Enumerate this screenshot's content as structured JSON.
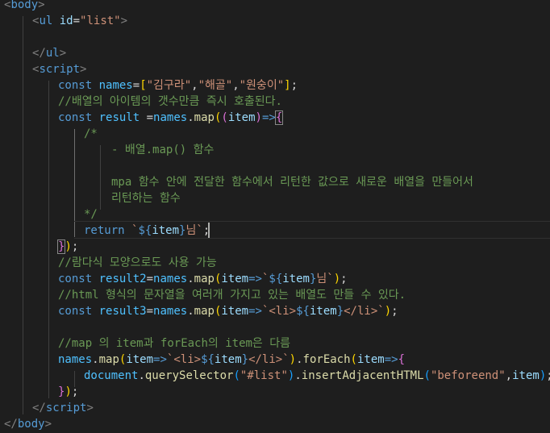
{
  "editor": {
    "html": {
      "body_tag": "body",
      "ul_tag": "ul",
      "id_attr": "id",
      "list_id_value": "\"list\"",
      "script_tag": "script"
    },
    "code": {
      "const_kw": "const",
      "names_var": "names",
      "names_array_strings": [
        "\"김구라\"",
        "\"해골\"",
        "\"원숭이\""
      ],
      "comment_1": "//배열의 아이템의 갯수만큼 즉시 호출된다.",
      "result_var": "result",
      "map_fn": "map",
      "item_param": "item",
      "block_comment_open": "/*",
      "block_comment_line_1": "- 배열.map() 함수",
      "block_comment_line_2": "mpa 함수 안에 전달한 함수에서 리턴한 값으로 새로운 배열을 만들어서",
      "block_comment_line_3": "리턴하는 함수",
      "block_comment_close": "*/",
      "return_kw": "return",
      "tpl_suffix_nim": "님`",
      "comment_2": "//람다식 모양으로도 사용 가능",
      "result2_var": "result2",
      "comment_3": "//html 형식의 문자열을 여러개 가지고 있는 배열도 만들 수 있다.",
      "result3_var": "result3",
      "tpl_li_open": "`<li>",
      "tpl_li_close": "</li>`",
      "comment_4": "//map 의 item과 forEach의 item은 다름",
      "forEach_fn": "forEach",
      "document_var": "document",
      "querySelector_fn": "querySelector",
      "selector_str": "\"#list\"",
      "insert_fn": "insertAdjacentHTML",
      "position_str": "\"beforeend\""
    }
  },
  "colors": {
    "background": "#1e1e1e",
    "tag": "#569cd6",
    "string": "#ce9178",
    "comment": "#6a9955",
    "variable": "#4fc1ff",
    "function": "#dcdcaa",
    "bracket_gold": "#ffd700",
    "bracket_purple": "#da70d6",
    "bracket_blue": "#179fff"
  }
}
